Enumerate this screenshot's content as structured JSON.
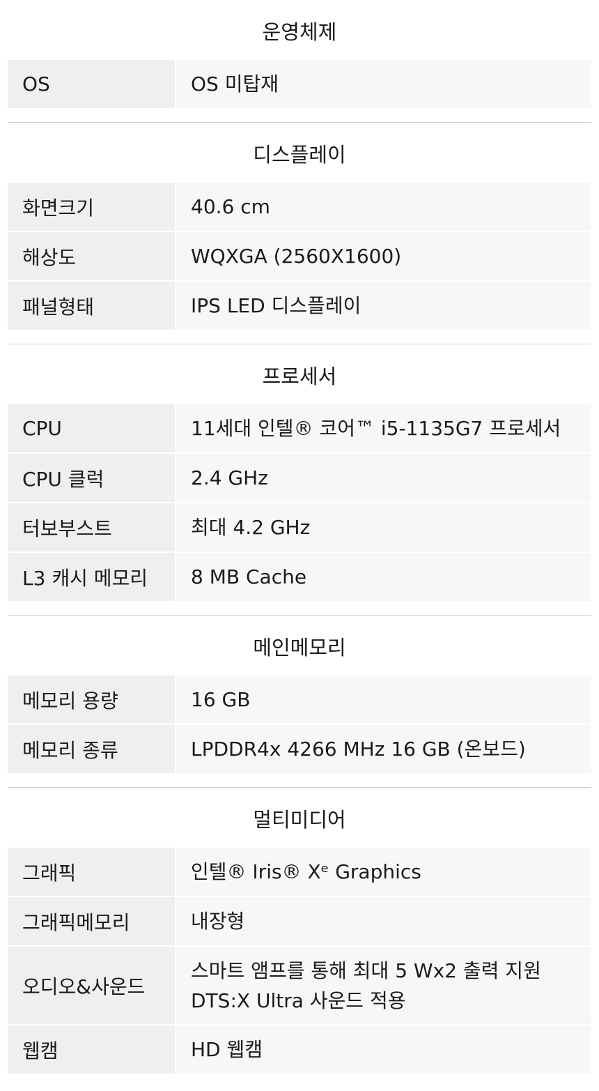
{
  "sections": [
    {
      "title": "운영체제",
      "rows": [
        {
          "label": "OS",
          "value": "OS 미탑재"
        }
      ]
    },
    {
      "title": "디스플레이",
      "rows": [
        {
          "label": "화면크기",
          "value": "40.6 cm"
        },
        {
          "label": "해상도",
          "value": "WQXGA (2560X1600)"
        },
        {
          "label": "패널형태",
          "value": "IPS LED 디스플레이"
        }
      ]
    },
    {
      "title": "프로세서",
      "rows": [
        {
          "label": "CPU",
          "value": "11세대 인텔® 코어™ i5-1135G7 프로세서"
        },
        {
          "label": "CPU 클럭",
          "value": "2.4 GHz"
        },
        {
          "label": "터보부스트",
          "value": "최대 4.2 GHz"
        },
        {
          "label": "L3 캐시 메모리",
          "value": "8 MB Cache"
        }
      ]
    },
    {
      "title": "메인메모리",
      "rows": [
        {
          "label": "메모리 용량",
          "value": "16 GB"
        },
        {
          "label": "메모리 종류",
          "value": "LPDDR4x 4266 MHz 16 GB (온보드)"
        }
      ]
    },
    {
      "title": "멀티미디어",
      "rows": [
        {
          "label": "그래픽",
          "value": "인텔® Iris® Xᵉ Graphics"
        },
        {
          "label": "그래픽메모리",
          "value": "내장형"
        },
        {
          "label": "오디오&사운드",
          "value": "스마트 앰프를 통해 최대 5 Wx2 출력 지원\nDTS:X Ultra 사운드 적용"
        },
        {
          "label": "웹캠",
          "value": "HD 웹캠"
        }
      ]
    }
  ]
}
